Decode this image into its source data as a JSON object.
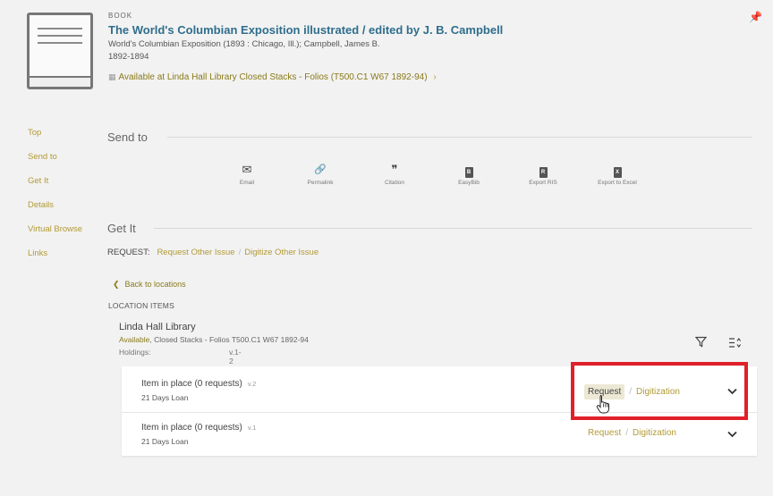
{
  "record": {
    "type_label": "BOOK",
    "title": "The World's Columbian Exposition illustrated / edited by J. B. Campbell",
    "subjects": "World's Columbian Exposition (1893 : Chicago, Ill.); Campbell, James B.",
    "dates": "1892-1894",
    "availability_prefix": "Available at",
    "library": "Linda Hall Library",
    "location": "Closed Stacks - Folios (T500.C1 W67 1892-94)",
    "chevron": "›"
  },
  "side_nav": [
    "Top",
    "Send to",
    "Get It",
    "Details",
    "Virtual Browse",
    "Links"
  ],
  "send_to": {
    "heading": "Send to",
    "actions": [
      {
        "label": "Email",
        "icon": "email-icon",
        "glyph": "✉"
      },
      {
        "label": "Permalink",
        "icon": "link-icon",
        "glyph": "🔗"
      },
      {
        "label": "Citation",
        "icon": "quote-icon",
        "glyph": "❞"
      },
      {
        "label": "EasyBib",
        "icon": "easybib-icon",
        "glyph": "B"
      },
      {
        "label": "Export RIS",
        "icon": "export-ris-icon",
        "glyph": "R"
      },
      {
        "label": "Export to Excel",
        "icon": "export-excel-icon",
        "glyph": "X"
      }
    ]
  },
  "get_it": {
    "heading": "Get It",
    "request_label": "REQUEST:",
    "request_other_issue": "Request Other Issue",
    "digitize_other_issue": "Digitize Other Issue",
    "back_to_locations": "Back to locations",
    "location_items_label": "LOCATION ITEMS",
    "library_name": "Linda Hall Library",
    "availability": "Available",
    "location_detail": ", Closed Stacks - Folios T500.C1 W67 1892-94",
    "holdings_label": "Holdings:",
    "holdings_value": "v.1-2",
    "items": [
      {
        "status": "Item in place (0 requests)",
        "volume": "v.2",
        "loan": "21 Days Loan",
        "request": "Request",
        "digitization": "Digitization"
      },
      {
        "status": "Item in place (0 requests)",
        "volume": "v.1",
        "loan": "21 Days Loan",
        "request": "Request",
        "digitization": "Digitization"
      }
    ],
    "separator": "/"
  },
  "colors": {
    "link_gold": "#b29a35",
    "title_blue": "#2f6e8c",
    "highlight_red": "#e0202a"
  }
}
